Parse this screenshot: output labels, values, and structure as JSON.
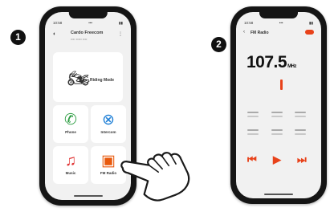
{
  "steps": [
    "1",
    "2"
  ],
  "phone1": {
    "status": {
      "left": "10:58",
      "center": "•••",
      "right": "▮▮"
    },
    "header": {
      "title": "Cardo Freecom",
      "subtitle": "•••• ••••• ••••"
    },
    "riding_mode": {
      "label": "Riding Mode"
    },
    "tiles": [
      {
        "label": "Phone",
        "icon": "phone-icon",
        "glyph": "✆",
        "color": "#2f9e44"
      },
      {
        "label": "Intercom",
        "icon": "intercom-icon",
        "glyph": "⊗",
        "color": "#1c7ed6"
      },
      {
        "label": "Music",
        "icon": "music-icon",
        "glyph": "♫",
        "color": "#e03131"
      },
      {
        "label": "FM Radio",
        "icon": "radio-icon",
        "glyph": "▣",
        "color": "#e8590c"
      }
    ]
  },
  "phone2": {
    "status": {
      "left": "10:58",
      "center": "•••",
      "right": "▮▮"
    },
    "header": {
      "back": "‹",
      "title": "FM Radio"
    },
    "frequency": "107.5",
    "unit": "MHz",
    "controls": {
      "prev": "⏮",
      "play": "▶",
      "next": "⏭"
    }
  },
  "colors": {
    "accent": "#e8421a",
    "phone_body": "#151515",
    "screen_bg": "#f1f1f1"
  }
}
